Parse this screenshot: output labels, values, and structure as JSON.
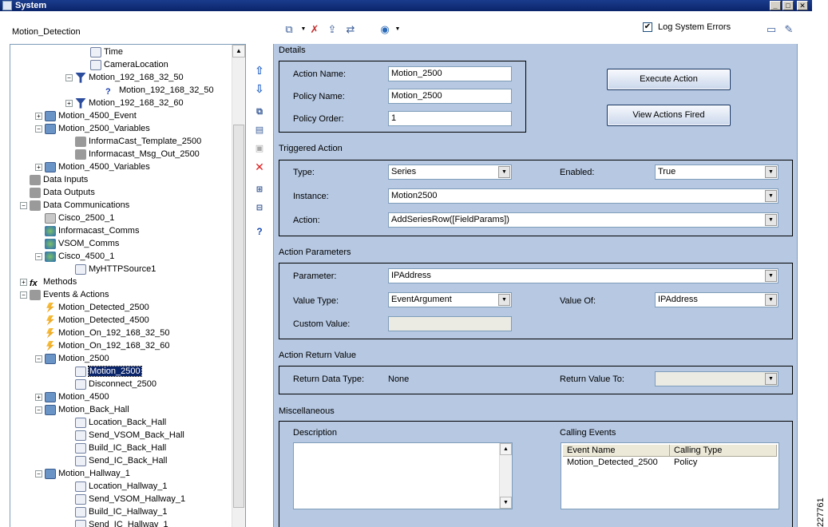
{
  "window": {
    "title": "System",
    "minimize": "_",
    "maximize": "□",
    "close": "✕"
  },
  "left_panel": {
    "title": "Motion_Detection"
  },
  "tree": [
    {
      "label": "Time",
      "icon": "grid-icon",
      "indent": 4,
      "exp": ""
    },
    {
      "label": "CameraLocation",
      "icon": "grid-icon",
      "indent": 4,
      "exp": ""
    },
    {
      "label": "Motion_192_168_32_50",
      "icon": "filter-icon",
      "indent": 3,
      "exp": "−"
    },
    {
      "label": "Motion_192_168_32_50",
      "icon": "question-icon",
      "indent": 5,
      "exp": ""
    },
    {
      "label": "Motion_192_168_32_60",
      "icon": "filter-icon",
      "indent": 3,
      "exp": "+"
    },
    {
      "label": "Motion_4500_Event",
      "icon": "script-icon",
      "indent": 1,
      "exp": "+"
    },
    {
      "label": "Motion_2500_Variables",
      "icon": "script-icon",
      "indent": 1,
      "exp": "−"
    },
    {
      "label": "InformaCast_Template_2500",
      "icon": "data-icon",
      "indent": 3,
      "exp": ""
    },
    {
      "label": "Informacast_Msg_Out_2500",
      "icon": "data-icon",
      "indent": 3,
      "exp": ""
    },
    {
      "label": "Motion_4500_Variables",
      "icon": "script-icon",
      "indent": 1,
      "exp": "+"
    },
    {
      "label": "Data Inputs",
      "icon": "data-icon",
      "indent": 0,
      "exp": ""
    },
    {
      "label": "Data Outputs",
      "icon": "data-icon",
      "indent": 0,
      "exp": ""
    },
    {
      "label": "Data Communications",
      "icon": "network-icon",
      "indent": 0,
      "exp": "−"
    },
    {
      "label": "Cisco_2500_1",
      "icon": "folder-icon",
      "indent": 1,
      "exp": ""
    },
    {
      "label": "Informacast_Comms",
      "icon": "globe-icon",
      "indent": 1,
      "exp": ""
    },
    {
      "label": "VSOM_Comms",
      "icon": "globe-icon",
      "indent": 1,
      "exp": ""
    },
    {
      "label": "Cisco_4500_1",
      "icon": "globe-icon",
      "indent": 1,
      "exp": "−"
    },
    {
      "label": "MyHTTPSource1",
      "icon": "grid-icon",
      "indent": 3,
      "exp": ""
    },
    {
      "label": "Methods",
      "icon": "fx-icon",
      "indent": 0,
      "exp": "+"
    },
    {
      "label": "Events & Actions",
      "icon": "gear-icon",
      "indent": 0,
      "exp": "−"
    },
    {
      "label": "Motion_Detected_2500",
      "icon": "event-icon",
      "indent": 1,
      "exp": ""
    },
    {
      "label": "Motion_Detected_4500",
      "icon": "event-icon",
      "indent": 1,
      "exp": ""
    },
    {
      "label": "Motion_On_192_168_32_50",
      "icon": "event-icon",
      "indent": 1,
      "exp": ""
    },
    {
      "label": "Motion_On_192_168_32_60",
      "icon": "event-icon",
      "indent": 1,
      "exp": ""
    },
    {
      "label": "Motion_2500",
      "icon": "script-icon",
      "indent": 1,
      "exp": "−"
    },
    {
      "label": "Motion_2500",
      "icon": "action-icon",
      "indent": 3,
      "exp": "",
      "selected": true
    },
    {
      "label": "Disconnect_2500",
      "icon": "action-icon",
      "indent": 3,
      "exp": ""
    },
    {
      "label": "Motion_4500",
      "icon": "script-icon",
      "indent": 1,
      "exp": "+"
    },
    {
      "label": "Motion_Back_Hall",
      "icon": "script-icon",
      "indent": 1,
      "exp": "−"
    },
    {
      "label": "Location_Back_Hall",
      "icon": "action-icon",
      "indent": 3,
      "exp": ""
    },
    {
      "label": "Send_VSOM_Back_Hall",
      "icon": "action-icon",
      "indent": 3,
      "exp": ""
    },
    {
      "label": "Build_IC_Back_Hall",
      "icon": "action-icon",
      "indent": 3,
      "exp": ""
    },
    {
      "label": "Send_IC_Back_Hall",
      "icon": "action-icon",
      "indent": 3,
      "exp": ""
    },
    {
      "label": "Motion_Hallway_1",
      "icon": "script-icon",
      "indent": 1,
      "exp": "−"
    },
    {
      "label": "Location_Hallway_1",
      "icon": "action-icon",
      "indent": 3,
      "exp": ""
    },
    {
      "label": "Send_VSOM_Hallway_1",
      "icon": "action-icon",
      "indent": 3,
      "exp": ""
    },
    {
      "label": "Build_IC_Hallway_1",
      "icon": "action-icon",
      "indent": 3,
      "exp": ""
    },
    {
      "label": "Send_IC_Hallway_1",
      "icon": "action-icon",
      "indent": 3,
      "exp": ""
    }
  ],
  "toolbar": {
    "log_errors_label": "Log System Errors",
    "log_errors_checked": true
  },
  "details": {
    "section": "Details",
    "action_name_label": "Action Name:",
    "action_name": "Motion_2500",
    "policy_name_label": "Policy Name:",
    "policy_name": "Motion_2500",
    "policy_order_label": "Policy Order:",
    "policy_order": "1",
    "execute_button": "Execute Action",
    "view_fired_button": "View Actions Fired"
  },
  "triggered": {
    "section": "Triggered Action",
    "type_label": "Type:",
    "type": "Series",
    "enabled_label": "Enabled:",
    "enabled": "True",
    "instance_label": "Instance:",
    "instance": "Motion2500",
    "action_label": "Action:",
    "action": "AddSeriesRow([FieldParams])"
  },
  "params": {
    "section": "Action Parameters",
    "parameter_label": "Parameter:",
    "parameter": "IPAddress",
    "value_type_label": "Value Type:",
    "value_type": "EventArgument",
    "value_of_label": "Value Of:",
    "value_of": "IPAddress",
    "custom_value_label": "Custom Value:",
    "custom_value": ""
  },
  "return": {
    "section": "Action Return Value",
    "type_label": "Return Data Type:",
    "type": "None",
    "to_label": "Return Value To:",
    "to": ""
  },
  "misc": {
    "section": "Miscellaneous",
    "description_label": "Description",
    "description": "",
    "calling_label": "Calling Events",
    "columns": [
      "Event Name",
      "Calling Type"
    ],
    "rows": [
      [
        "Motion_Detected_2500",
        "Policy"
      ]
    ]
  },
  "figure_number": "227761"
}
